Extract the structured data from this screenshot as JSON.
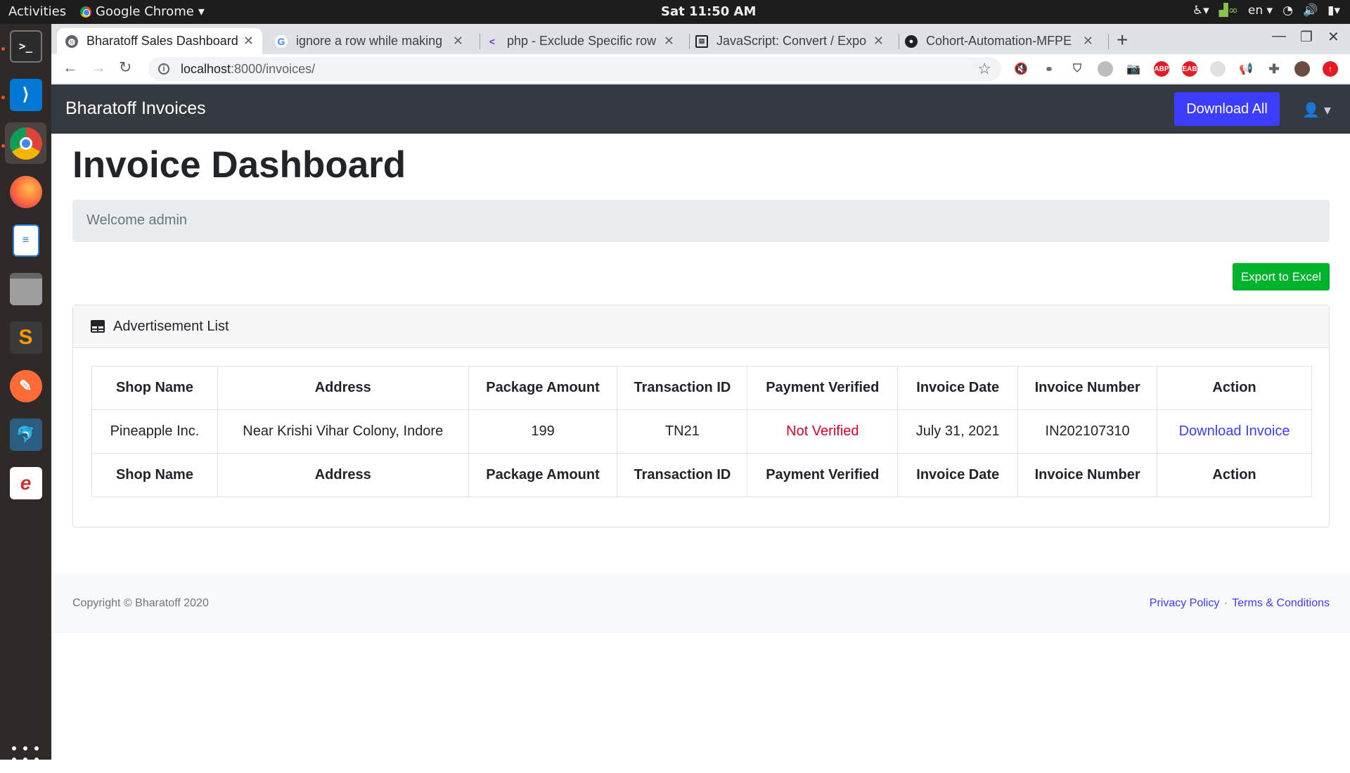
{
  "system": {
    "activities": "Activities",
    "app_name": "Google Chrome",
    "clock": "Sat 11:50 AM",
    "language": "en"
  },
  "tabs": [
    {
      "title": "Bharatoff Sales Dashboard",
      "active": true
    },
    {
      "title": "ignore a row while making",
      "active": false
    },
    {
      "title": "php - Exclude Specific row",
      "active": false
    },
    {
      "title": "JavaScript: Convert / Expo",
      "active": false
    },
    {
      "title": "Cohort-Automation-MFPE",
      "active": false
    }
  ],
  "address_bar": {
    "host": "localhost",
    "path": ":8000/invoices/"
  },
  "navbar": {
    "brand": "Bharatoff Invoices",
    "download_all": "Download All"
  },
  "page": {
    "title": "Invoice Dashboard",
    "welcome": "Welcome admin",
    "export_button": "Export to Excel"
  },
  "card": {
    "title": "Advertisement List"
  },
  "table": {
    "headers": [
      "Shop Name",
      "Address",
      "Package Amount",
      "Transaction ID",
      "Payment Verified",
      "Invoice Date",
      "Invoice Number",
      "Action"
    ],
    "rows": [
      {
        "shop_name": "Pineapple Inc.",
        "address": "Near Krishi Vihar Colony, Indore",
        "package_amount": "199",
        "transaction_id": "TN21",
        "payment_verified": "Not Verified",
        "invoice_date": "July 31, 2021",
        "invoice_number": "IN202107310",
        "action": "Download Invoice"
      }
    ]
  },
  "footer": {
    "copyright": "Copyright © Bharatoff 2020",
    "privacy": "Privacy Policy",
    "separator": "·",
    "terms": "Terms & Conditions"
  },
  "colors": {
    "navbar_bg": "#343a40",
    "primary": "#3d3dff",
    "success": "#00b32c",
    "danger": "#e0002a"
  }
}
